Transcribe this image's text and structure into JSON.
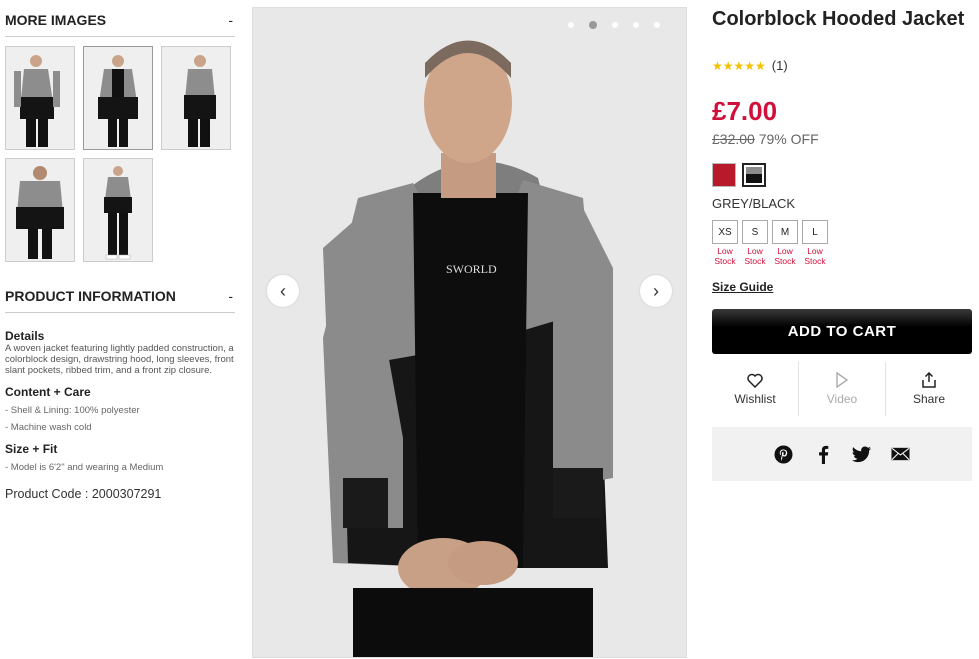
{
  "sidebar": {
    "more_images": {
      "title": "MORE IMAGES",
      "toggle": "-"
    },
    "product_information": {
      "title": "PRODUCT INFORMATION",
      "toggle": "-"
    },
    "details": {
      "title": "Details",
      "text": "A woven jacket featuring lightly padded construction, a colorblock design, drawstring hood, long sleeves, front slant pockets, ribbed trim, and a front zip closure."
    },
    "content_care": {
      "title": "Content + Care",
      "items": [
        "- Shell & Lining: 100% polyester",
        "- Machine wash cold"
      ]
    },
    "size_fit": {
      "title": "Size + Fit",
      "items": [
        "- Model is 6'2\" and wearing a Medium"
      ]
    },
    "product_code": "Product Code : 2000307291"
  },
  "product": {
    "title": "Colorblock Hooded Jacket",
    "stars": "★★★★★",
    "reviews": "(1)",
    "price": "£7.00",
    "old_price": "£32.00",
    "discount": "79% OFF",
    "color_name": "GREY/BLACK",
    "sizes": [
      {
        "label": "XS",
        "stock": "Low Stock"
      },
      {
        "label": "S",
        "stock": "Low Stock"
      },
      {
        "label": "M",
        "stock": "Low Stock"
      },
      {
        "label": "L",
        "stock": "Low Stock"
      }
    ],
    "size_guide": "Size Guide",
    "add_to_cart": "ADD TO CART",
    "actions": {
      "wishlist": "Wishlist",
      "video": "Video",
      "share": "Share"
    }
  },
  "gallery": {
    "prev_icon": "‹",
    "next_icon": "›",
    "dot_count": 5,
    "active_dot": 1
  },
  "colors": {
    "price": "#d0103a",
    "swatch_red": "#b81a2c",
    "jacket_grey": "#8b8b8b",
    "jacket_black": "#111111"
  }
}
